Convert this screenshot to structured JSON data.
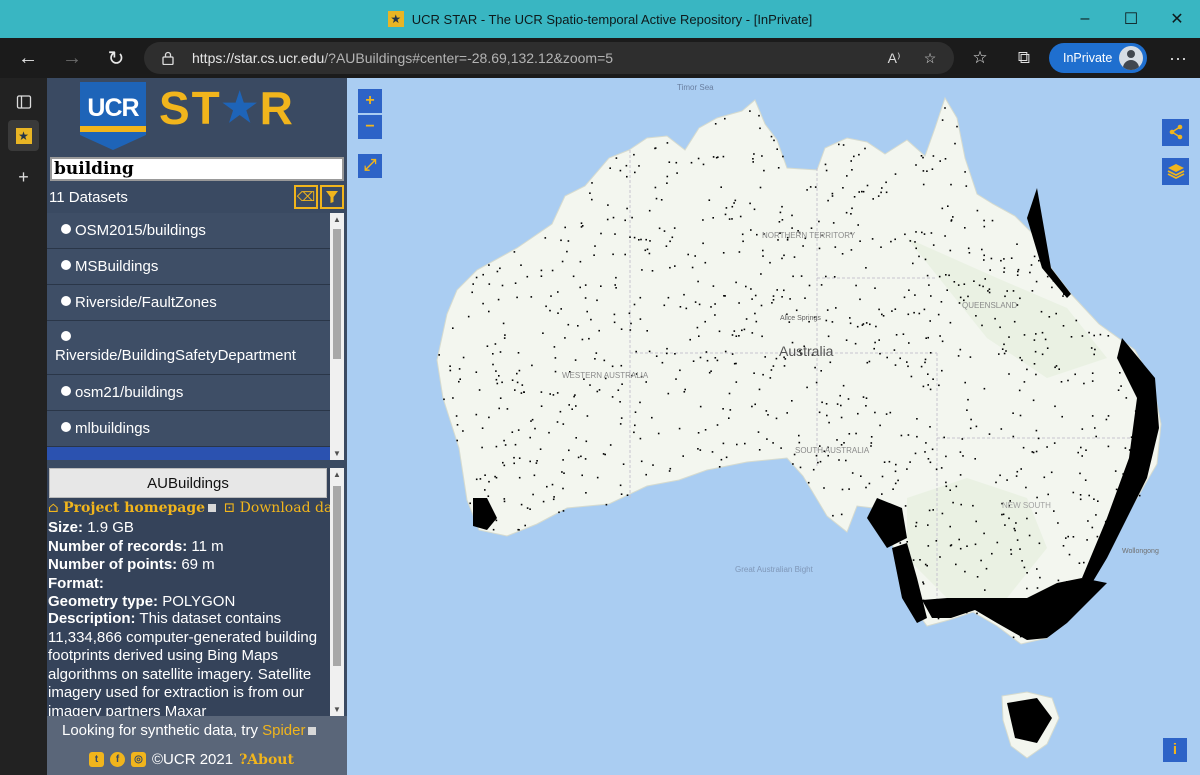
{
  "window": {
    "title": "UCR STAR - The UCR Spatio-temporal Active Repository - [InPrivate]",
    "minimize": "–",
    "maximize": "☐",
    "close": "✕"
  },
  "toolbar": {
    "url_host": "https://star.cs.ucr.edu",
    "url_rest": "/?AUBuildings#center=-28.69,132.12&zoom=5",
    "inprivate_label": "InPrivate"
  },
  "sidebar": {
    "search_value": "building",
    "dataset_count": "11 Datasets",
    "datasets": [
      {
        "label": "OSM2015/buildings"
      },
      {
        "label": "MSBuildings"
      },
      {
        "label": "Riverside/FaultZones"
      },
      {
        "label": "Riverside/BuildingSafetyDepartment"
      },
      {
        "label": "osm21/buildings"
      },
      {
        "label": "mlbuildings"
      }
    ],
    "details": {
      "title": "AUBuildings",
      "project_homepage": "Project homepage",
      "download": "Download data",
      "size_label": "Size:",
      "size_value": "1.9 GB",
      "records_label": "Number of records:",
      "records_value": "11 m",
      "points_label": "Number of points:",
      "points_value": "69 m",
      "format_label": "Format:",
      "geom_label": "Geometry type:",
      "geom_value": "POLYGON",
      "desc_label": "Description:",
      "desc_value": "This dataset contains 11,334,866 computer-generated building footprints derived using Bing Maps algorithms on satellite imagery. Satellite imagery used for extraction is from our imagery partners Maxar"
    },
    "footer": {
      "synthetic_text": "Looking for synthetic data, try",
      "spider": "Spider",
      "copyright": "©UCR 2021",
      "about": "About"
    }
  },
  "map": {
    "zoom_in": "+",
    "zoom_out": "−",
    "labels": {
      "timor_sea": "Timor Sea",
      "northern_territory": "NORTHERN TERRITORY",
      "queensland": "QUEENSLAND",
      "alice_springs": "Alice Springs",
      "australia": "Australia",
      "western_australia": "WESTERN AUSTRALIA",
      "south_australia": "SOUTH AUSTRALIA",
      "new_south_wales": "NEW SOUTH",
      "wollongong": "Wollongong",
      "great_australian_bight": "Great Australian Bight"
    }
  }
}
